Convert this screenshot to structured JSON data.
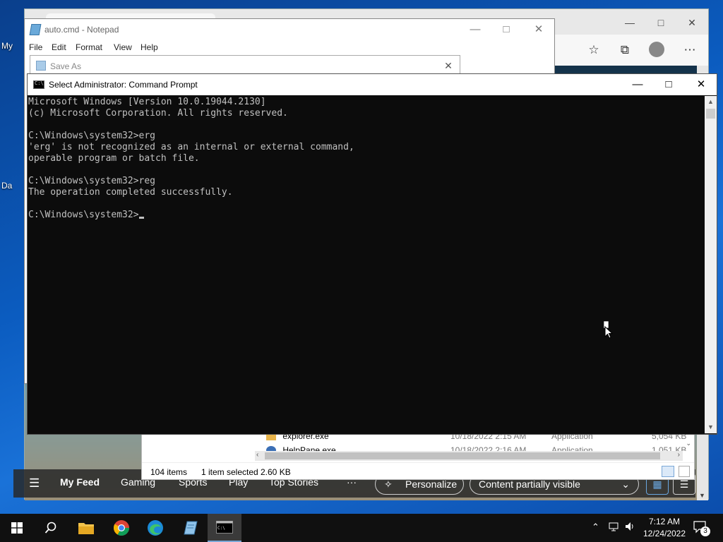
{
  "desktop": {
    "icon_labels": [
      "My",
      "Da"
    ]
  },
  "edge": {
    "feed": {
      "items": [
        "My Feed",
        "Gaming",
        "Sports",
        "Play",
        "Top Stories"
      ],
      "more": "···",
      "personalize_label": "Personalize",
      "content_visibility_label": "Content partially visible"
    }
  },
  "explorer": {
    "rows": [
      {
        "name": "explorer.exe",
        "date": "10/18/2022 2:15 AM",
        "type": "Application",
        "size": "5,054 KB"
      },
      {
        "name": "HelpPane.exe",
        "date": "10/18/2022 2:16 AM",
        "type": "Application",
        "size": "1,051 KB"
      }
    ],
    "status": {
      "items_count": "104 items",
      "selected": "1 item selected",
      "selected_size": "2.60 KB"
    }
  },
  "notepad": {
    "title": "auto.cmd - Notepad",
    "menus": [
      "File",
      "Edit",
      "Format",
      "View",
      "Help"
    ]
  },
  "save_as": {
    "title": "Save As"
  },
  "cmd": {
    "title": "Select Administrator: Command Prompt",
    "lines": [
      "Microsoft Windows [Version 10.0.19044.2130]",
      "(c) Microsoft Corporation. All rights reserved.",
      "",
      "C:\\Windows\\system32>erg",
      "'erg' is not recognized as an internal or external command,",
      "operable program or batch file.",
      "",
      "C:\\Windows\\system32>reg",
      "The operation completed successfully.",
      ""
    ],
    "prompt": "C:\\Windows\\system32>"
  },
  "taskbar": {
    "apps": [
      "start",
      "search",
      "file-explorer",
      "chrome",
      "edge",
      "notepad",
      "command-prompt"
    ],
    "clock_time": "7:12 AM",
    "clock_date": "12/24/2022",
    "notification_count": "3"
  }
}
